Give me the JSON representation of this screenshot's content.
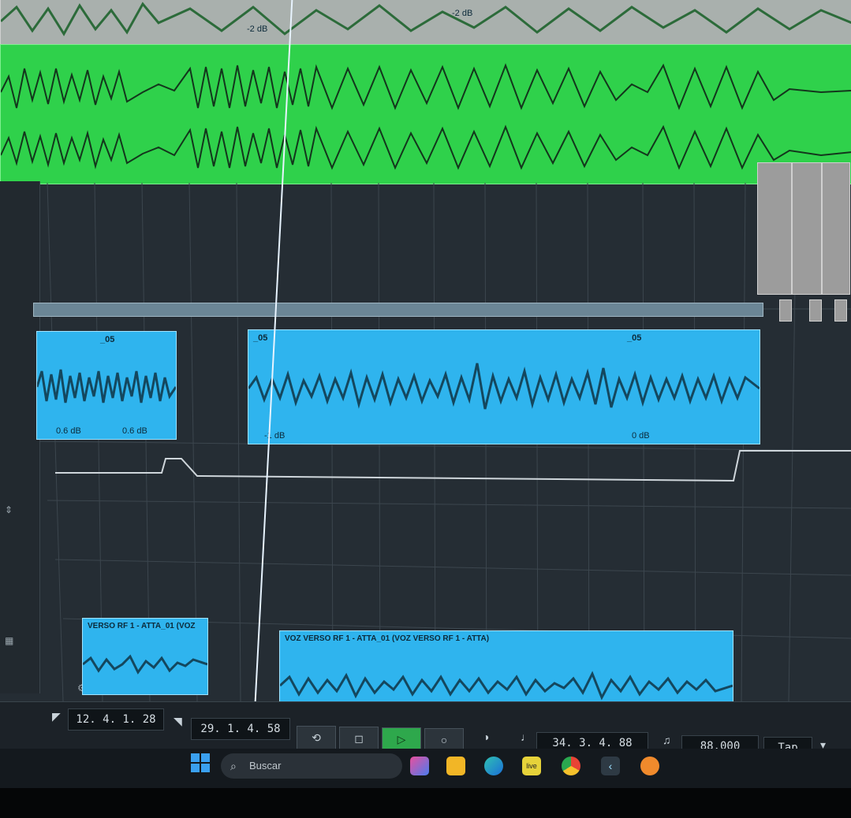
{
  "clips": {
    "top_gain_a": "-2 dB",
    "top_gain_b": "-2 dB",
    "mid_left_name_1": "_05",
    "mid_left_gain_1": "0.6 dB",
    "mid_left_gain_2": "0.6 dB",
    "mid_main_name_1": "_05",
    "mid_main_gain_1": "-1 dB",
    "mid_main_name_2": "_05",
    "mid_main_gain_2": "0 dB",
    "vocal_left_name": "VERSO RF 1 - ATTA_01 (VOZ",
    "vocal_main_name": "VOZ VERSO RF 1 - ATTA_01 (VOZ VERSO RF 1 - ATTA)"
  },
  "transport": {
    "left_locator": "12. 4. 1. 28",
    "right_locator": "29. 1. 4. 58",
    "position": "34. 3. 4. 88",
    "tempo": "88.000",
    "tap_label": "Tap"
  },
  "taskbar": {
    "search_placeholder": "Buscar",
    "live_label": "live"
  },
  "colors": {
    "green_clip": "#2fd14b",
    "blue_clip": "#2fb4ee",
    "play_button": "#2ea84c"
  }
}
